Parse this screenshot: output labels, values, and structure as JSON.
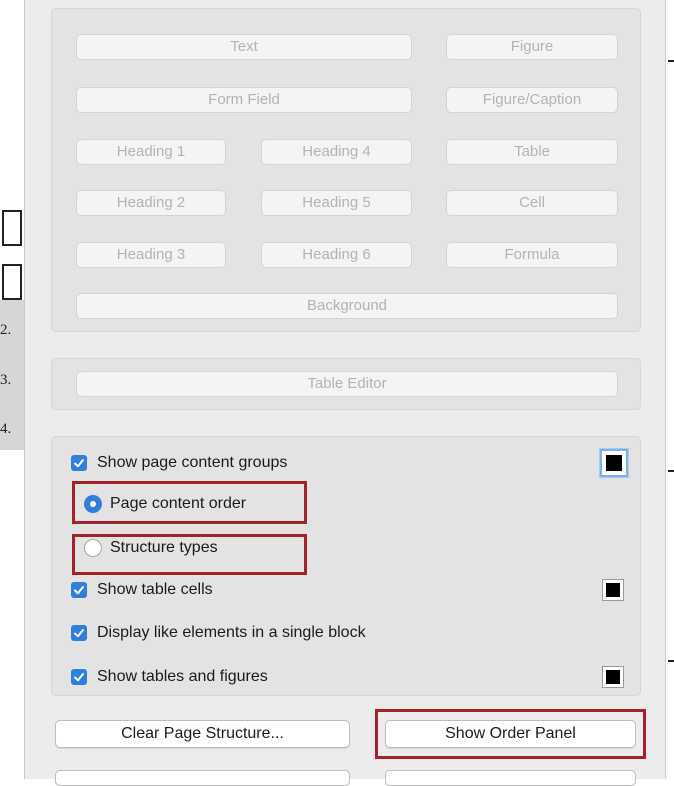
{
  "left_strip": {
    "row_numbers": [
      "2.",
      "3.",
      "4."
    ]
  },
  "tags": {
    "text": "Text",
    "figure": "Figure",
    "form_field": "Form Field",
    "figure_caption": "Figure/Caption",
    "heading_1": "Heading 1",
    "heading_2": "Heading 2",
    "heading_3": "Heading 3",
    "heading_4": "Heading 4",
    "heading_5": "Heading 5",
    "heading_6": "Heading 6",
    "table": "Table",
    "cell": "Cell",
    "formula": "Formula",
    "background": "Background"
  },
  "table_editor": {
    "label": "Table Editor"
  },
  "options": {
    "show_page_content_groups": "Show page content groups",
    "page_content_order": "Page content order",
    "structure_types": "Structure types",
    "show_table_cells": "Show table cells",
    "display_like_elements": "Display like elements in a single block",
    "show_tables_and_figures": "Show tables and figures"
  },
  "state": {
    "show_page_content_groups": true,
    "page_content_order_selected": true,
    "show_table_cells": true,
    "display_like_elements": true,
    "show_tables_and_figures": true
  },
  "actions": {
    "clear_page_structure": "Clear Page Structure...",
    "show_order_panel": "Show Order Panel"
  },
  "colors": {
    "accent": "#2f7fdb",
    "annotation": "#a6202c",
    "panel_bg": "#ececec",
    "disabled_text": "#b3b3b3"
  },
  "icons": {
    "checkbox": "checkmark-icon",
    "swatch": "color-swatch-icon"
  }
}
